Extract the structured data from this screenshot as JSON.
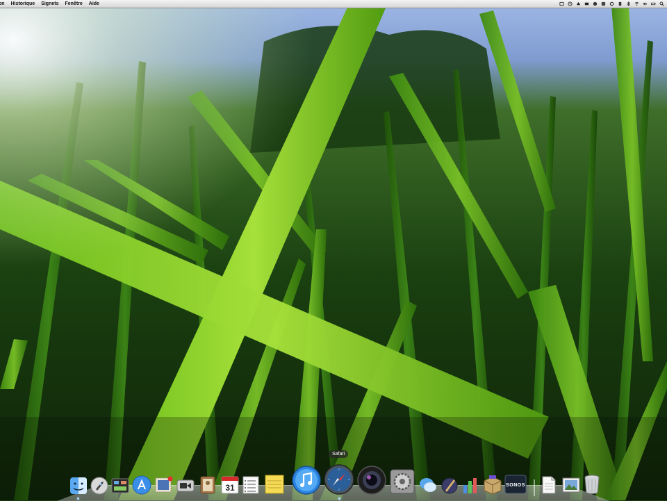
{
  "menubar": {
    "items": [
      {
        "label": "on"
      },
      {
        "label": "Historique"
      },
      {
        "label": "Signets"
      },
      {
        "label": "Fenêtre"
      },
      {
        "label": "Aide"
      }
    ],
    "status_icons": [
      "status-icon-1",
      "status-icon-2",
      "status-icon-3",
      "status-icon-4",
      "status-icon-5",
      "status-icon-6",
      "status-icon-7",
      "status-icon-8",
      "bluetooth-icon",
      "wifi-icon",
      "volume-icon",
      "battery-icon",
      "spotlight-icon"
    ]
  },
  "dock": {
    "tooltip": "Safari",
    "apps": [
      {
        "name": "finder",
        "icon": "finder-icon",
        "running": true
      },
      {
        "name": "launchpad",
        "icon": "rocket-icon",
        "running": false
      },
      {
        "name": "mission-control",
        "icon": "mission-control-icon",
        "running": false
      },
      {
        "name": "app-store",
        "icon": "app-store-icon",
        "running": false
      },
      {
        "name": "mail",
        "icon": "mail-stamp-icon",
        "running": false
      },
      {
        "name": "facetime",
        "icon": "video-camera-icon",
        "running": false
      },
      {
        "name": "address-book",
        "icon": "address-book-icon",
        "running": false
      },
      {
        "name": "calendar",
        "icon": "calendar-icon",
        "running": false,
        "day": "31"
      },
      {
        "name": "reminders",
        "icon": "checklist-icon",
        "running": false
      },
      {
        "name": "notes",
        "icon": "notes-icon",
        "running": false
      },
      {
        "name": "itunes",
        "icon": "music-note-icon",
        "running": false
      },
      {
        "name": "safari",
        "icon": "compass-icon",
        "running": true
      },
      {
        "name": "photo-booth",
        "icon": "camera-lens-icon",
        "running": false
      },
      {
        "name": "system-preferences",
        "icon": "gear-icon",
        "running": false
      },
      {
        "name": "messages",
        "icon": "chat-bubbles-icon",
        "running": false
      },
      {
        "name": "preview",
        "icon": "pen-icon",
        "running": false
      },
      {
        "name": "activity-monitor",
        "icon": "bar-chart-icon",
        "running": false
      },
      {
        "name": "installer",
        "icon": "box-icon",
        "running": false
      },
      {
        "name": "sonos",
        "icon": "sonos-icon",
        "running": false,
        "label": "SONOS"
      },
      {
        "name": "documents-stack",
        "icon": "document-icon",
        "running": false
      },
      {
        "name": "downloads-stack",
        "icon": "image-stack-icon",
        "running": false
      },
      {
        "name": "trash",
        "icon": "trash-icon",
        "running": false
      }
    ]
  }
}
